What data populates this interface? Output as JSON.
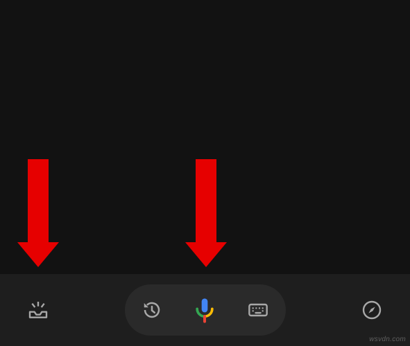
{
  "colors": {
    "background": "#121212",
    "bottom_bar": "#1e1e1e",
    "pill": "#2a2a2a",
    "icon": "#a8a8a8",
    "arrow": "#e60000",
    "mic_blue": "#4285f4",
    "mic_red": "#ea4335",
    "mic_yellow": "#fbbc05",
    "mic_green": "#34a853"
  },
  "bottom_bar": {
    "left_icon": "inbox-icon",
    "pill": {
      "left_icon": "history-icon",
      "center_icon": "mic-icon",
      "right_icon": "keyboard-icon"
    },
    "right_icon": "compass-icon"
  },
  "annotations": {
    "arrow_left_target": "inbox-icon",
    "arrow_right_target": "mic-icon"
  },
  "watermark": "wsvdn.com"
}
